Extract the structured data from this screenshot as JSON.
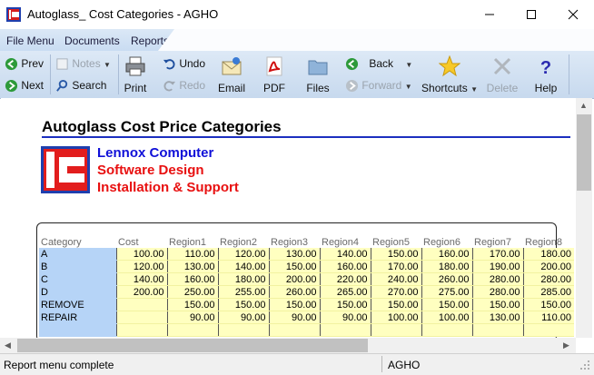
{
  "window": {
    "title": "Autoglass_ Cost Categories - AGHO"
  },
  "menu": {
    "items": [
      "File Menu",
      "Documents",
      "Reports"
    ]
  },
  "toolbar": {
    "prev": "Prev",
    "next": "Next",
    "notes": "Notes",
    "search": "Search",
    "print": "Print",
    "undo": "Undo",
    "redo": "Redo",
    "email": "Email",
    "pdf": "PDF",
    "files": "Files",
    "back": "Back",
    "forward": "Forward",
    "shortcuts": "Shortcuts",
    "delete": "Delete",
    "help": "Help"
  },
  "report": {
    "title": "Autoglass Cost Price Categories",
    "company_lines": [
      "Lennox Computer",
      "Software Design",
      "Installation & Support"
    ],
    "columns": [
      "Category",
      "Cost",
      "Region1",
      "Region2",
      "Region3",
      "Region4",
      "Region5",
      "Region6",
      "Region7",
      "Region8"
    ],
    "rows": [
      [
        "A",
        "100.00",
        "110.00",
        "120.00",
        "130.00",
        "140.00",
        "150.00",
        "160.00",
        "170.00",
        "180.00"
      ],
      [
        "B",
        "120.00",
        "130.00",
        "140.00",
        "150.00",
        "160.00",
        "170.00",
        "180.00",
        "190.00",
        "200.00"
      ],
      [
        "C",
        "140.00",
        "160.00",
        "180.00",
        "200.00",
        "220.00",
        "240.00",
        "260.00",
        "280.00",
        "280.00"
      ],
      [
        "D",
        "200.00",
        "250.00",
        "255.00",
        "260.00",
        "265.00",
        "270.00",
        "275.00",
        "280.00",
        "285.00"
      ],
      [
        "REMOVE",
        "",
        "150.00",
        "150.00",
        "150.00",
        "150.00",
        "150.00",
        "150.00",
        "150.00",
        "150.00"
      ],
      [
        "REPAIR",
        "",
        "90.00",
        "90.00",
        "90.00",
        "90.00",
        "100.00",
        "100.00",
        "130.00",
        "110.00"
      ],
      [
        "",
        "",
        "",
        "",
        "",
        "",
        "",
        "",
        "",
        ""
      ]
    ]
  },
  "status": {
    "message": "Report menu complete",
    "database": "AGHO"
  },
  "colors": {
    "company_line_1": "#1010d8",
    "company_line_2": "#e81010",
    "company_line_3": "#e81010",
    "rule": "#1c2fc0",
    "cell_fill": "#ffffc0",
    "category_fill": "#b6d4f7"
  }
}
